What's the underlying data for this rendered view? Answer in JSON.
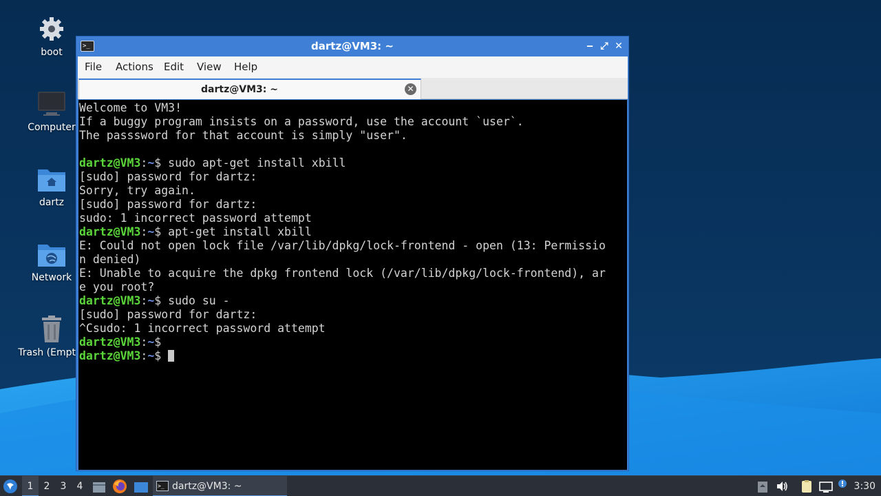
{
  "desktop": {
    "icons": [
      {
        "label": "boot",
        "icon": "gear-icon"
      },
      {
        "label": "Computer",
        "icon": "monitor-icon"
      },
      {
        "label": "dartz",
        "icon": "home-folder-icon"
      },
      {
        "label": "Network",
        "icon": "network-folder-icon"
      },
      {
        "label": "Trash (Empty)",
        "icon": "trash-icon"
      }
    ]
  },
  "window": {
    "title": "dartz@VM3: ~",
    "buttons": {
      "minimize": "‒",
      "maximize": "⤢",
      "close": "✕"
    },
    "menu": [
      "File",
      "Actions",
      "Edit",
      "View",
      "Help"
    ],
    "tab": {
      "label": "dartz@VM3: ~",
      "close": "✕"
    }
  },
  "terminal": {
    "prompt_user": "dartz@VM3",
    "prompt_path": "~",
    "lines": [
      {
        "type": "out",
        "text": "Welcome to VM3!"
      },
      {
        "type": "out",
        "text": "If a buggy program insists on a password, use the account `user`."
      },
      {
        "type": "out",
        "text": "The passsword for that account is simply \"user\"."
      },
      {
        "type": "out",
        "text": ""
      },
      {
        "type": "cmd",
        "text": "sudo apt-get install xbill"
      },
      {
        "type": "out",
        "text": "[sudo] password for dartz:"
      },
      {
        "type": "out",
        "text": "Sorry, try again."
      },
      {
        "type": "out",
        "text": "[sudo] password for dartz:"
      },
      {
        "type": "out",
        "text": "sudo: 1 incorrect password attempt"
      },
      {
        "type": "cmd",
        "text": "apt-get install xbill"
      },
      {
        "type": "out",
        "text": "E: Could not open lock file /var/lib/dpkg/lock-frontend - open (13: Permissio"
      },
      {
        "type": "out",
        "text": "n denied)"
      },
      {
        "type": "out",
        "text": "E: Unable to acquire the dpkg frontend lock (/var/lib/dpkg/lock-frontend), ar"
      },
      {
        "type": "out",
        "text": "e you root?"
      },
      {
        "type": "cmd",
        "text": "sudo su -"
      },
      {
        "type": "out",
        "text": "[sudo] password for dartz:"
      },
      {
        "type": "out",
        "text": "^Csudo: 1 incorrect password attempt"
      },
      {
        "type": "cmd",
        "text": ""
      },
      {
        "type": "cmd",
        "text": "",
        "cursor": true
      }
    ]
  },
  "taskbar": {
    "workspaces": [
      "1",
      "2",
      "3",
      "4"
    ],
    "active_workspace": "1",
    "task_label": "dartz@VM3: ~",
    "clock": "3:30"
  },
  "colors": {
    "titlebar": "#3f80d6",
    "prompt_user": "#5bd63a",
    "prompt_path": "#6b8ee0",
    "terminal_bg": "#000000",
    "taskbar_bg": "#2b3038"
  }
}
